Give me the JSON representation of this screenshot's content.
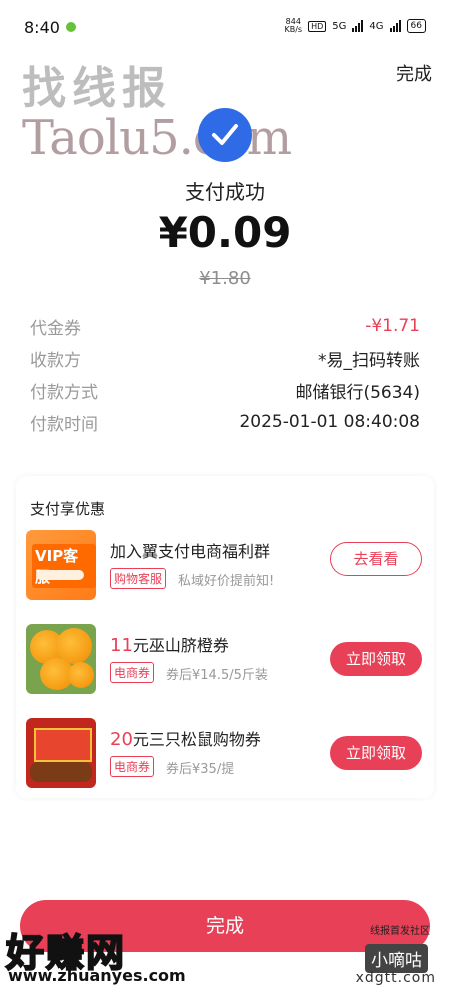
{
  "status_bar": {
    "time": "8:40",
    "speed_value": "844",
    "speed_unit": "KB/s",
    "hd": "HD",
    "net1": "5G",
    "net2": "4G",
    "battery": "66"
  },
  "watermarks": {
    "top_cn": "找线报",
    "top_en": "Taolu5.com",
    "bottom_left_cn": "好赚网",
    "bottom_left_url": "www.zhuanyes.com",
    "bottom_right_top": "线报首发社区",
    "bottom_right_mid": "小嘀咕",
    "bottom_right_url": "xdgtt.com"
  },
  "header": {
    "done_label": "完成"
  },
  "result": {
    "title": "支付成功",
    "amount": "¥0.09",
    "original_amount": "¥1.80"
  },
  "details": [
    {
      "label": "代金券",
      "value": "-¥1.71",
      "highlight": true
    },
    {
      "label": "收款方",
      "value": "*易_扫码转账",
      "highlight": false
    },
    {
      "label": "付款方式",
      "value": "邮储银行(5634)",
      "highlight": false
    },
    {
      "label": "付款时间",
      "value": "2025-01-01 08:40:08",
      "highlight": false
    }
  ],
  "promo": {
    "title": "支付享优惠",
    "items": [
      {
        "title": "加入翼支付电商福利群",
        "tag": "购物客服",
        "desc": "私域好价提前知!",
        "button": "去看看",
        "thumb_text": "VIP客服"
      },
      {
        "num": "11",
        "title": "元巫山脐橙券",
        "tag": "电商券",
        "desc": "券后¥14.5/5斤装",
        "button": "立即领取"
      },
      {
        "num": "20",
        "title": "元三只松鼠购物券",
        "tag": "电商券",
        "desc": "券后¥35/提",
        "button": "立即领取"
      }
    ]
  },
  "footer": {
    "done_label": "完成"
  },
  "colors": {
    "accent": "#e84057",
    "check": "#2f6be6"
  }
}
